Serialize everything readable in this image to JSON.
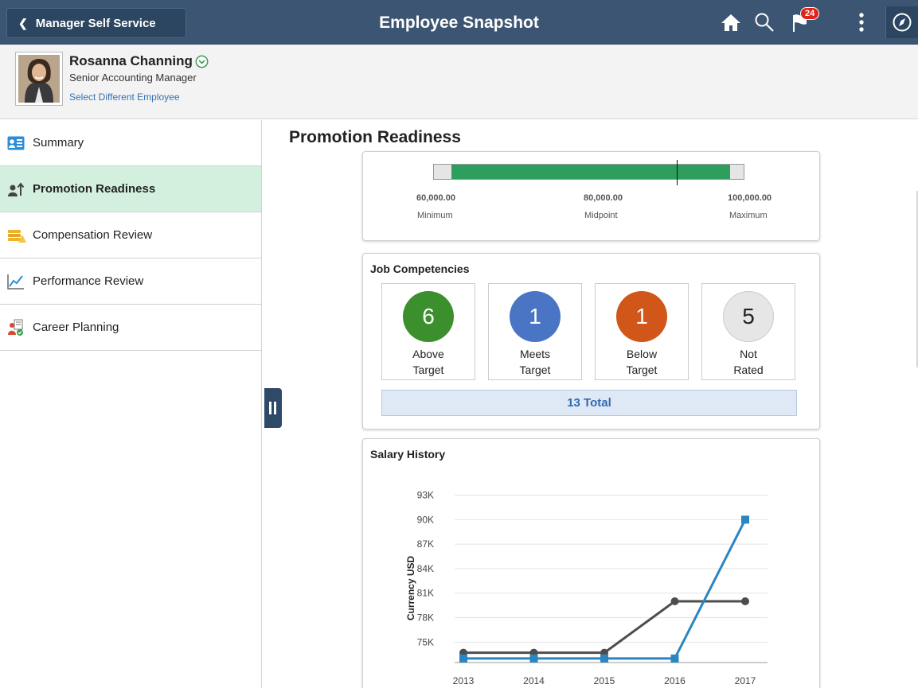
{
  "header": {
    "back_label": "Manager Self Service",
    "title": "Employee Snapshot",
    "notification_count": "24",
    "icons": [
      "home-icon",
      "search-icon",
      "flag-icon",
      "more-icon",
      "navbar-icon"
    ]
  },
  "employee": {
    "name": "Rosanna Channing",
    "title": "Senior Accounting Manager",
    "select_link": "Select Different Employee"
  },
  "sidebar": {
    "items": [
      {
        "label": "Summary",
        "icon": "id-card-icon"
      },
      {
        "label": "Promotion Readiness",
        "icon": "promotion-icon"
      },
      {
        "label": "Compensation Review",
        "icon": "coins-icon"
      },
      {
        "label": "Performance Review",
        "icon": "trend-chart-icon"
      },
      {
        "label": "Career Planning",
        "icon": "career-icon"
      }
    ],
    "selected": "Promotion Readiness"
  },
  "main": {
    "section_title": "Promotion Readiness",
    "salary_range": {
      "min_value": "60,000.00",
      "min_label": "Minimum",
      "mid_value": "80,000.00",
      "mid_label": "Midpoint",
      "max_value": "100,000.00",
      "max_label": "Maximum",
      "current_fraction": 0.7
    },
    "competencies": {
      "title": "Job Competencies",
      "items": [
        {
          "count": "6",
          "line1": "Above",
          "line2": "Target",
          "color": "#3b8f2d"
        },
        {
          "count": "1",
          "line1": "Meets",
          "line2": "Target",
          "color": "#4a74c4"
        },
        {
          "count": "1",
          "line1": "Below",
          "line2": "Target",
          "color": "#d0561a"
        },
        {
          "count": "5",
          "line1": "Not",
          "line2": "Rated",
          "color": "#e6e6e6"
        }
      ],
      "total": "13 Total"
    },
    "salary_history": {
      "title": "Salary History"
    }
  },
  "chart_data": {
    "type": "line",
    "ylabel": "Currency USD",
    "x": [
      "2013",
      "2014",
      "2015",
      "2016",
      "2017"
    ],
    "yticks": [
      "75K",
      "78K",
      "81K",
      "84K",
      "87K",
      "90K",
      "93K"
    ],
    "ytick_values": [
      75,
      78,
      81,
      84,
      87,
      90,
      93
    ],
    "ylim": [
      72.5,
      95
    ],
    "series": [
      {
        "values": [
          73.7,
          73.7,
          73.7,
          80,
          80
        ],
        "color": "#4d4d4d",
        "marker": "circle"
      },
      {
        "values": [
          73.0,
          73.0,
          73.0,
          73.0,
          90
        ],
        "color": "#2b85c1",
        "marker": "square"
      }
    ],
    "grid": true
  }
}
